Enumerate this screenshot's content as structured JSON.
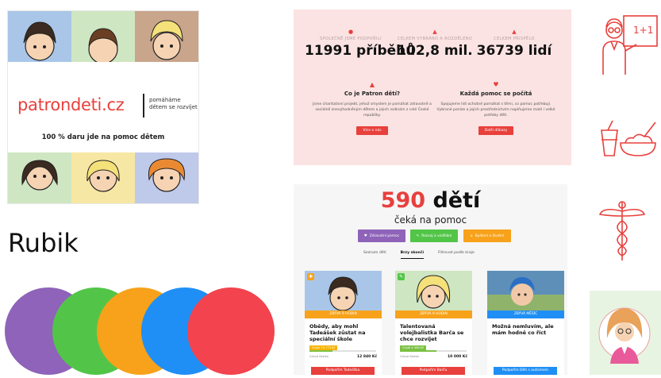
{
  "logo_card": {
    "brand": "patrondeti.cz",
    "tagline": "pomáháme dětem se rozvíjet",
    "subline": "100 % daru jde na pomoc dětem",
    "tile_colors": [
      "#a9c6e8",
      "#cfe6c2",
      "#c9a58c",
      "#a9c6e8",
      "#f7e7a4",
      "#bfc9ea"
    ]
  },
  "font_title": "Rubik",
  "circles": [
    "#8e63b9",
    "#52c548",
    "#f7a21a",
    "#1f8ff5",
    "#f2434e"
  ],
  "stats_panel": {
    "stats": [
      {
        "label": "SPOLEČNĚ JSME PODPOŘILI",
        "value": "11991 příběhů"
      },
      {
        "label": "CELKEM VYBRÁNO A ROZDĚLENO",
        "value": "102,8 mil."
      },
      {
        "label": "CELKEM PŘISPĚLO",
        "value": "36739 lidí"
      }
    ],
    "columns": [
      {
        "heading": "Co je Patron dětí?",
        "text": "Jsme charitativní projekt, jehož smyslem je pomáhat zdravotně a sociálně znevýhodněným dětem a jejich rodinám z celé České republiky.",
        "button": "Více o nás"
      },
      {
        "heading": "Každá pomoc se počítá",
        "text": "Spojujeme lidi ochotné pomáhat s těmi, co pomoc potřebují. Vybrané peníze a jejich prostřednictvím naplňujeme malé i velké potřeby dětí.",
        "button": "Další důkazy"
      }
    ]
  },
  "kids_panel": {
    "count": "590",
    "count_word": "dětí",
    "subtitle": "čeká na pomoc",
    "filters": [
      "Zdravotní pomoc",
      "Rozvoj a vzdělání",
      "Bydlení a životní"
    ],
    "filter_colors": [
      "#8e63b9",
      "#52c548",
      "#f7a21a"
    ],
    "tabs": [
      "Seznam dětí",
      "Brzy skončí",
      "Filtrovat podle kraje"
    ],
    "active_tab": "Brzy skončí",
    "cards": [
      {
        "band": "ZBÝVÁ 9 HODIN",
        "band_color": "#f7a21a",
        "title": "Obědy, aby mohl Tadeášek zůstat na speciální škole",
        "chip": "Chybí 70 775 Kč",
        "progress": 0.35,
        "meta": "Cílová částka",
        "amount": "12 840 Kč",
        "button": "Podpořím Tadeáška",
        "corner_color": "#f7a21a",
        "corner_symbol": "✚",
        "photo_bg": "#a9c6e8"
      },
      {
        "band": "ZBÝVÁ 9 HODIN",
        "band_color": "#f7a21a",
        "title": "Talentovaná volejbalistka Barča se chce rozvíjet",
        "chip": "Chybí 4 398 Kč",
        "progress": 0.55,
        "meta": "Cílová částka",
        "amount": "10 000 Kč",
        "button": "Podpořím Barču",
        "corner_color": "#52c548",
        "corner_symbol": "✎",
        "photo_bg": "#cfe6c2"
      },
      {
        "band": "ZBÝVÁ MĚSÍC",
        "band_color": "#1f8ff5",
        "title": "Možná nemluvím, ale mám hodně co říct",
        "chip": "",
        "progress": 0,
        "meta": "",
        "amount": "",
        "button": "Podpořím Děti s autismem",
        "corner_color": "",
        "corner_symbol": "",
        "photo_bg": "#5e8fb8"
      }
    ]
  },
  "side_icons": [
    "teacher-icon",
    "food-icon",
    "medical-caduceus-icon",
    "doctor-avatar-icon"
  ]
}
